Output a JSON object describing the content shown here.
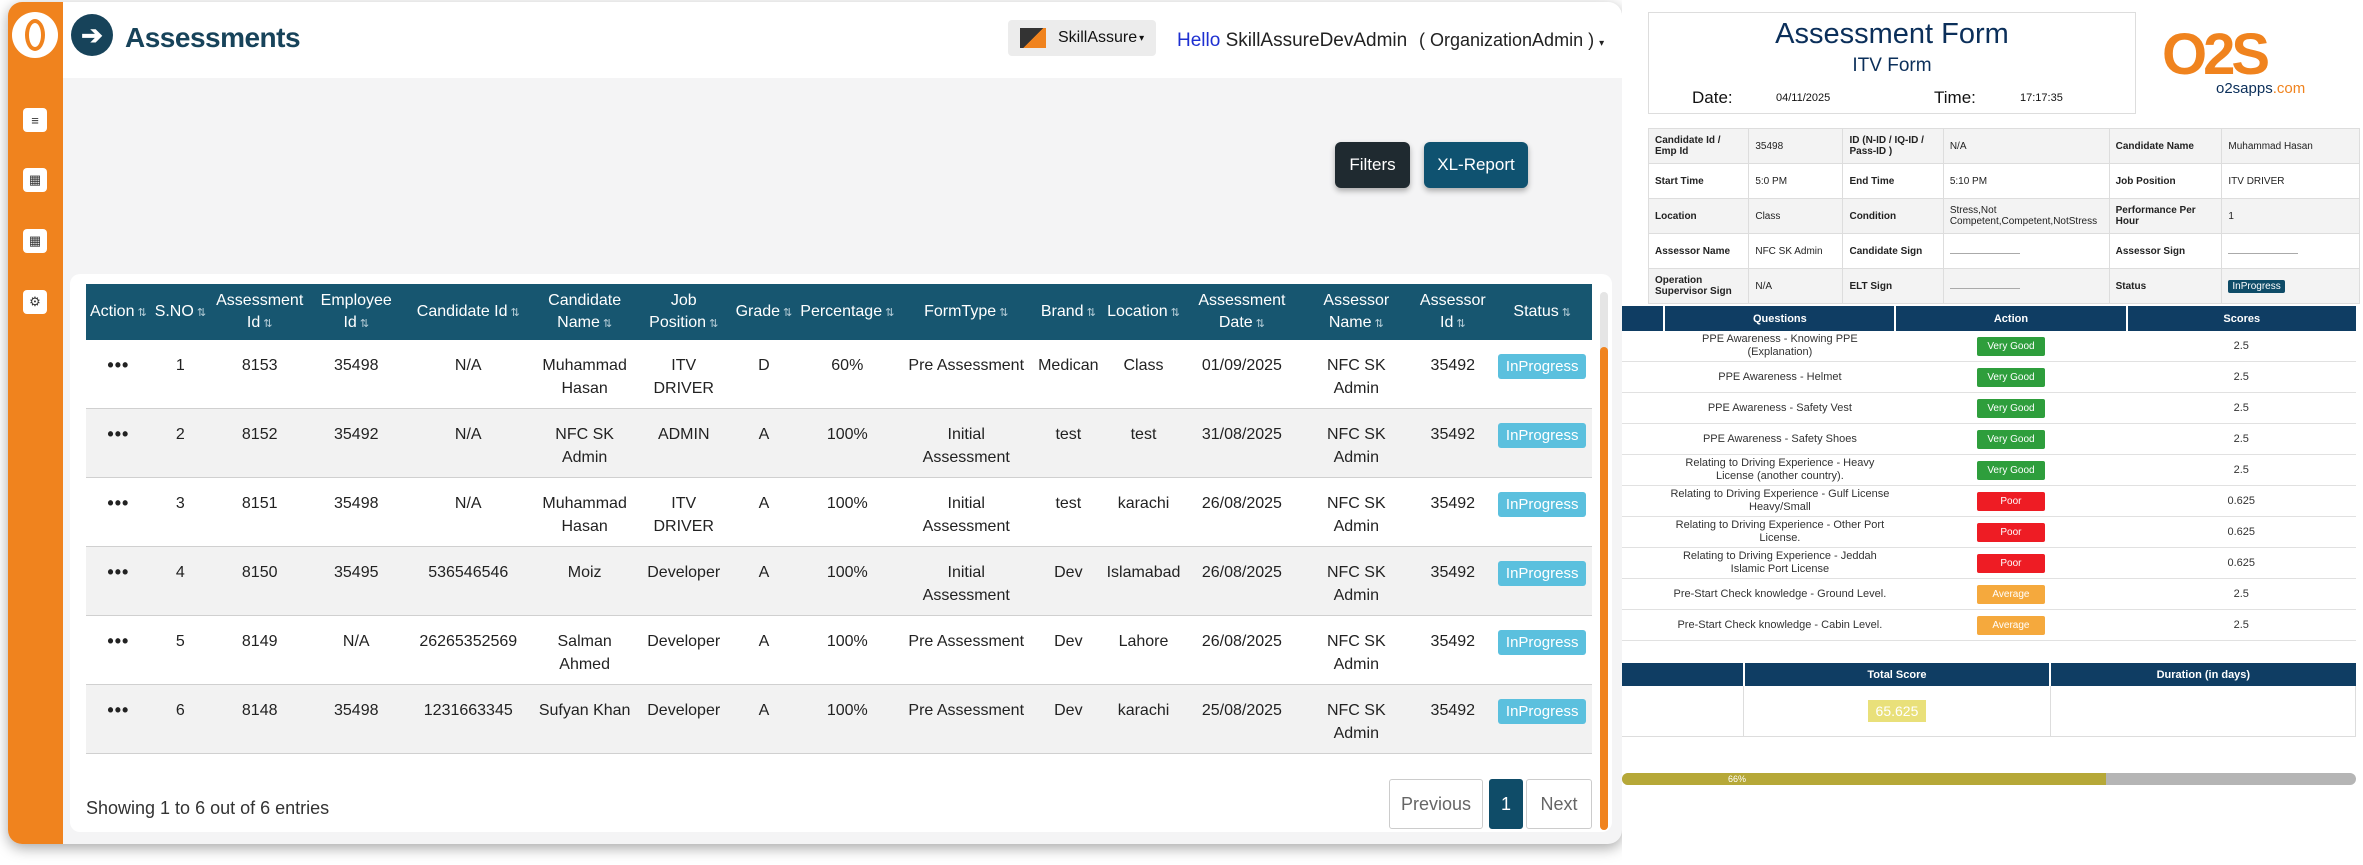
{
  "app": {
    "title": "Assessments",
    "brand": "SkillAssure",
    "hello": "Hello",
    "username": "SkillAssureDevAdmin",
    "role": "( OrganizationAdmin )",
    "filters_label": "Filters",
    "xl_report_label": "XL-Report"
  },
  "sidebar": {
    "icons": [
      "list-icon",
      "calendar-icon",
      "calendar-icon",
      "gear-icon"
    ]
  },
  "table": {
    "headers": [
      "Action",
      "S.NO",
      "Assessment Id",
      "Employee Id",
      "Candidate Id",
      "Candidate Name",
      "Job Position",
      "Grade",
      "Percentage",
      "FormType",
      "Brand",
      "Location",
      "Assessment Date",
      "Assessor Name",
      "Assessor Id",
      "Status"
    ],
    "rows": [
      {
        "action": "•••",
        "sno": "1",
        "assessment_id": "8153",
        "employee_id": "35498",
        "candidate_id": "N/A",
        "candidate_name": "Muhammad Hasan",
        "job_position": "ITV DRIVER",
        "grade": "D",
        "percentage": "60%",
        "form_type": "Pre Assessment",
        "brand": "Medican",
        "location": "Class",
        "date": "01/09/2025",
        "assessor_name": "NFC SK Admin",
        "assessor_id": "35492",
        "status": "InProgress"
      },
      {
        "action": "•••",
        "sno": "2",
        "assessment_id": "8152",
        "employee_id": "35492",
        "candidate_id": "N/A",
        "candidate_name": "NFC SK Admin",
        "job_position": "ADMIN",
        "grade": "A",
        "percentage": "100%",
        "form_type": "Initial Assessment",
        "brand": "test",
        "location": "test",
        "date": "31/08/2025",
        "assessor_name": "NFC SK Admin",
        "assessor_id": "35492",
        "status": "InProgress"
      },
      {
        "action": "•••",
        "sno": "3",
        "assessment_id": "8151",
        "employee_id": "35498",
        "candidate_id": "N/A",
        "candidate_name": "Muhammad Hasan",
        "job_position": "ITV DRIVER",
        "grade": "A",
        "percentage": "100%",
        "form_type": "Initial Assessment",
        "brand": "test",
        "location": "karachi",
        "date": "26/08/2025",
        "assessor_name": "NFC SK Admin",
        "assessor_id": "35492",
        "status": "InProgress"
      },
      {
        "action": "•••",
        "sno": "4",
        "assessment_id": "8150",
        "employee_id": "35495",
        "candidate_id": "536546546",
        "candidate_name": "Moiz",
        "job_position": "Developer",
        "grade": "A",
        "percentage": "100%",
        "form_type": "Initial Assessment",
        "brand": "Dev",
        "location": "Islamabad",
        "date": "26/08/2025",
        "assessor_name": "NFC SK Admin",
        "assessor_id": "35492",
        "status": "InProgress"
      },
      {
        "action": "•••",
        "sno": "5",
        "assessment_id": "8149",
        "employee_id": "N/A",
        "candidate_id": "26265352569",
        "candidate_name": "Salman Ahmed",
        "job_position": "Developer",
        "grade": "A",
        "percentage": "100%",
        "form_type": "Pre Assessment",
        "brand": "Dev",
        "location": "Lahore",
        "date": "26/08/2025",
        "assessor_name": "NFC SK Admin",
        "assessor_id": "35492",
        "status": "InProgress"
      },
      {
        "action": "•••",
        "sno": "6",
        "assessment_id": "8148",
        "employee_id": "35498",
        "candidate_id": "1231663345",
        "candidate_name": "Sufyan Khan",
        "job_position": "Developer",
        "grade": "A",
        "percentage": "100%",
        "form_type": "Pre Assessment",
        "brand": "Dev",
        "location": "karachi",
        "date": "25/08/2025",
        "assessor_name": "NFC SK Admin",
        "assessor_id": "35492",
        "status": "InProgress"
      }
    ],
    "showing": "Showing 1 to 6 out of 6 entries",
    "pagination": {
      "previous": "Previous",
      "current": "1",
      "next": "Next"
    }
  },
  "form": {
    "title": "Assessment Form",
    "subtitle": "ITV Form",
    "date_label": "Date:",
    "date_value": "04/11/2025",
    "time_label": "Time:",
    "time_value": "17:17:35",
    "logo_text": "O2S",
    "logo_sub_a": "o2sapps",
    "logo_sub_b": ".com",
    "info": [
      [
        "Candidate Id / Emp Id",
        "35498",
        "ID (N-ID / IQ-ID / Pass-ID )",
        "N/A",
        "Candidate Name",
        "Muhammad Hasan"
      ],
      [
        "Start Time",
        "5:0 PM",
        "End Time",
        "5:10 PM",
        "Job Position",
        "ITV DRIVER"
      ],
      [
        "Location",
        "Class",
        "Condition",
        "Stress,Not Competent,Competent,NotStress",
        "Performance Per Hour",
        "1"
      ],
      [
        "Assessor Name",
        "NFC SK Admin",
        "Candidate Sign",
        "",
        "Assessor Sign",
        ""
      ],
      [
        "Operation Supervisor Sign",
        "N/A",
        "ELT Sign",
        "",
        "Status",
        "InProgress"
      ]
    ],
    "questions_headers": [
      "Questions",
      "Action",
      "Scores"
    ],
    "questions": [
      {
        "q": "PPE Awareness - Knowing PPE (Explanation)",
        "rating": "Very Good",
        "color": "#2e9e3c",
        "score": "2.5"
      },
      {
        "q": "PPE Awareness - Helmet",
        "rating": "Very Good",
        "color": "#2e9e3c",
        "score": "2.5"
      },
      {
        "q": "PPE Awareness - Safety Vest",
        "rating": "Very Good",
        "color": "#2e9e3c",
        "score": "2.5"
      },
      {
        "q": "PPE Awareness - Safety Shoes",
        "rating": "Very Good",
        "color": "#2e9e3c",
        "score": "2.5"
      },
      {
        "q": "Relating to Driving Experience - Heavy License (another country).",
        "rating": "Very Good",
        "color": "#2e9e3c",
        "score": "2.5"
      },
      {
        "q": "Relating to Driving Experience - Gulf License Heavy/Small",
        "rating": "Poor",
        "color": "#ee1c24",
        "score": "0.625"
      },
      {
        "q": "Relating to Driving Experience - Other Port License.",
        "rating": "Poor",
        "color": "#ee1c24",
        "score": "0.625"
      },
      {
        "q": "Relating to Driving Experience - Jeddah Islamic Port License",
        "rating": "Poor",
        "color": "#ee1c24",
        "score": "0.625"
      },
      {
        "q": "Pre-Start Check knowledge - Ground Level.",
        "rating": "Average",
        "color": "#f5a93d",
        "score": "2.5"
      },
      {
        "q": "Pre-Start Check knowledge - Cabin Level.",
        "rating": "Average",
        "color": "#f5a93d",
        "score": "2.5"
      }
    ],
    "total_headers": [
      "Total Score",
      "Duration (in days)"
    ],
    "total_score": "65.625",
    "progress_label": "66%",
    "progress_fraction": 0.66
  }
}
